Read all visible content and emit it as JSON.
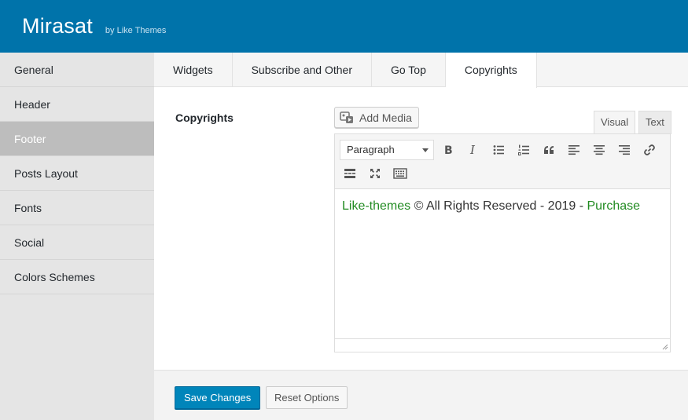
{
  "header": {
    "title": "Mirasat",
    "subtitle": "by Like Themes"
  },
  "sidebar": {
    "items": [
      {
        "label": "General"
      },
      {
        "label": "Header"
      },
      {
        "label": "Footer"
      },
      {
        "label": "Posts Layout"
      },
      {
        "label": "Fonts"
      },
      {
        "label": "Social"
      },
      {
        "label": "Colors Schemes"
      }
    ],
    "active": "Footer"
  },
  "tabs": {
    "items": [
      {
        "label": "Widgets"
      },
      {
        "label": "Subscribe and Other"
      },
      {
        "label": "Go Top"
      },
      {
        "label": "Copyrights"
      }
    ],
    "active": "Copyrights"
  },
  "field": {
    "label": "Copyrights"
  },
  "editor": {
    "add_media_label": "Add Media",
    "visual_tab": "Visual",
    "text_tab": "Text",
    "format_value": "Paragraph",
    "content": {
      "link1": "Like-themes",
      "middle": " © All Rights Reserved - 2019 - ",
      "link2": "Purchase"
    },
    "toolbar_icons": [
      "bold-icon",
      "italic-icon",
      "bullet-list-icon",
      "numbered-list-icon",
      "blockquote-icon",
      "align-left-icon",
      "align-center-icon",
      "align-right-icon",
      "link-icon",
      "read-more-icon",
      "fullscreen-icon",
      "toolbar-toggle-icon"
    ]
  },
  "actions": {
    "save_label": "Save Changes",
    "reset_label": "Reset Options"
  },
  "colors": {
    "header": "#0073aa",
    "primary_button": "#0085ba",
    "active_sidebar": "#bdbdbd",
    "link": "#228b22"
  }
}
